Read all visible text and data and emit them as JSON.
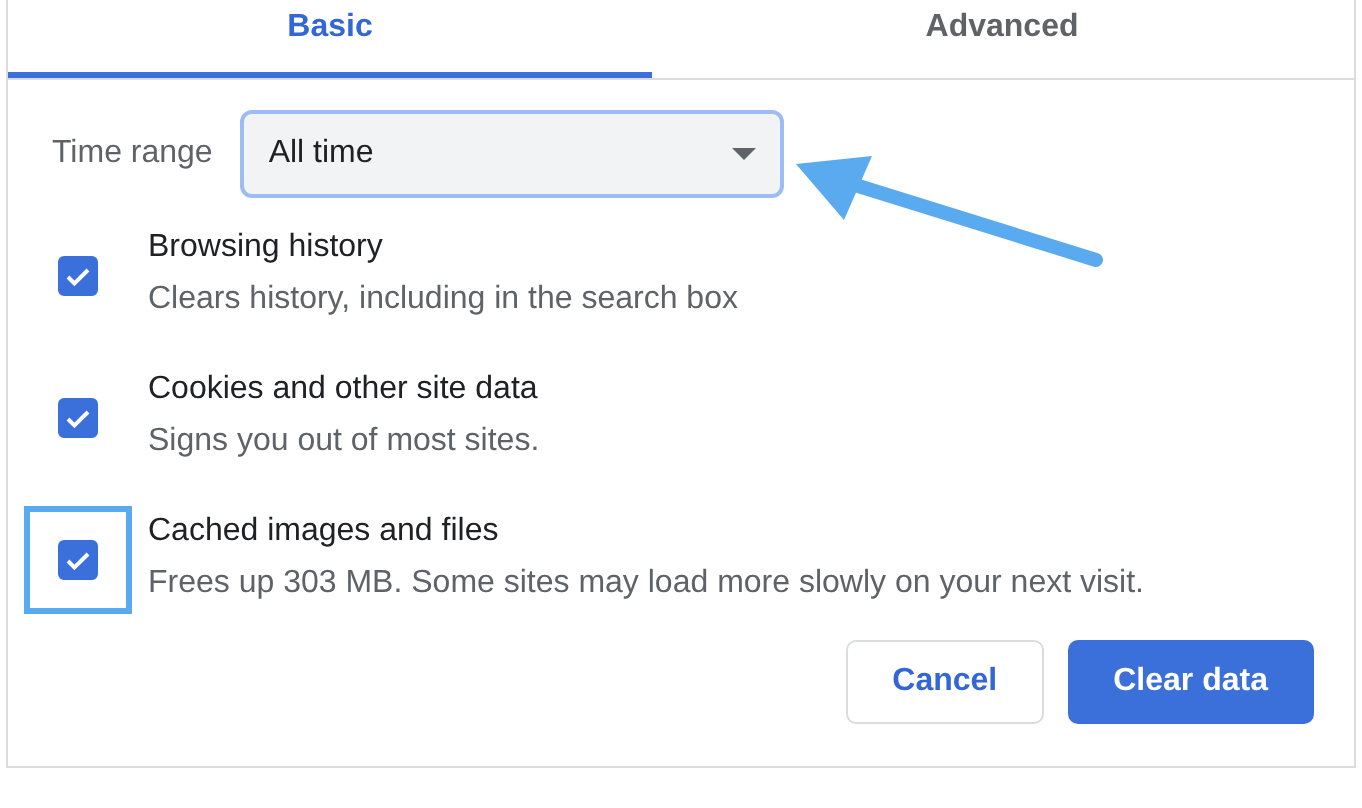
{
  "tabs": [
    {
      "label": "Basic",
      "selected": true
    },
    {
      "label": "Advanced",
      "selected": false
    }
  ],
  "time_range": {
    "label": "Time range",
    "value": "All time",
    "highlighted": true
  },
  "items": [
    {
      "title": "Browsing history",
      "description": "Clears history, including in the search box",
      "checked": true,
      "highlighted": false
    },
    {
      "title": "Cookies and other site data",
      "description": "Signs you out of most sites.",
      "checked": true,
      "highlighted": false
    },
    {
      "title": "Cached images and files",
      "description": "Frees up 303 MB. Some sites may load more slowly on your next visit.",
      "checked": true,
      "highlighted": true
    }
  ],
  "buttons": [
    {
      "label": "Cancel",
      "kind": "secondary"
    },
    {
      "label": "Clear data",
      "kind": "primary"
    }
  ]
}
